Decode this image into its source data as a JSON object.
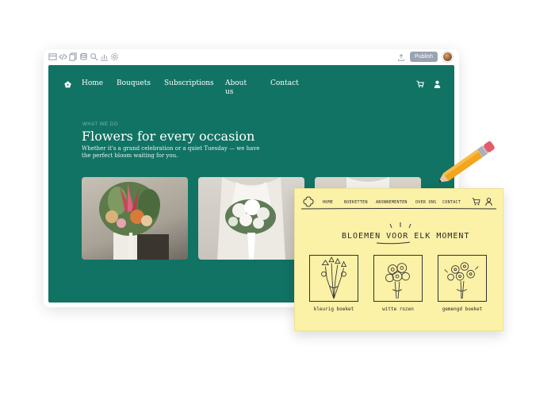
{
  "editor": {
    "toolbar_icons": [
      "layout-icon",
      "code-icon",
      "copy-icon",
      "database-icon",
      "search-icon",
      "chart-icon",
      "settings-icon"
    ],
    "publish_label": "Publish"
  },
  "site": {
    "nav": {
      "items": [
        "Home",
        "Bouquets",
        "Subscriptions",
        "About us",
        "Contact"
      ]
    },
    "hero": {
      "eyebrow": "WHAT WE DO",
      "title": "Flowers for every occasion",
      "subtitle": "Whether it's a grand celebration or a quiet Tuesday — we have the perfect bloom waiting for you."
    },
    "colors": {
      "brand": "#117364",
      "sticky": "#fbf1a7"
    }
  },
  "sketch": {
    "nav": [
      "HOME",
      "BOEKETTEN",
      "ABONNEMENTEN",
      "OVER ONS",
      "CONTACT"
    ],
    "title": "BLOEMEN VOOR ELK MOMENT",
    "captions": [
      "kleurig boeket",
      "witte rozen",
      "gemengd boeket"
    ]
  }
}
